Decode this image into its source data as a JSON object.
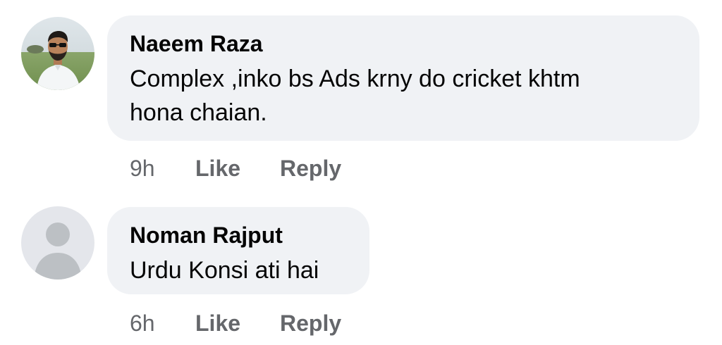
{
  "comments": [
    {
      "author": "Naeem Raza",
      "text_lines": [
        "Complex ,inko bs Ads krny do cricket khtm",
        "hona chaian."
      ],
      "time": "9h",
      "like_label": "Like",
      "reply_label": "Reply",
      "avatar": "profile-photo"
    },
    {
      "author": "Noman Rajput",
      "text_lines": [
        "Urdu Konsi ati hai"
      ],
      "time": "6h",
      "like_label": "Like",
      "reply_label": "Reply",
      "avatar": "default-person-icon"
    }
  ],
  "colors": {
    "bubble": "#f0f2f5",
    "text": "#050505",
    "secondary": "#65676b",
    "default_avatar_bg": "#e4e6eb",
    "default_avatar_fg": "#bcc0c4"
  }
}
